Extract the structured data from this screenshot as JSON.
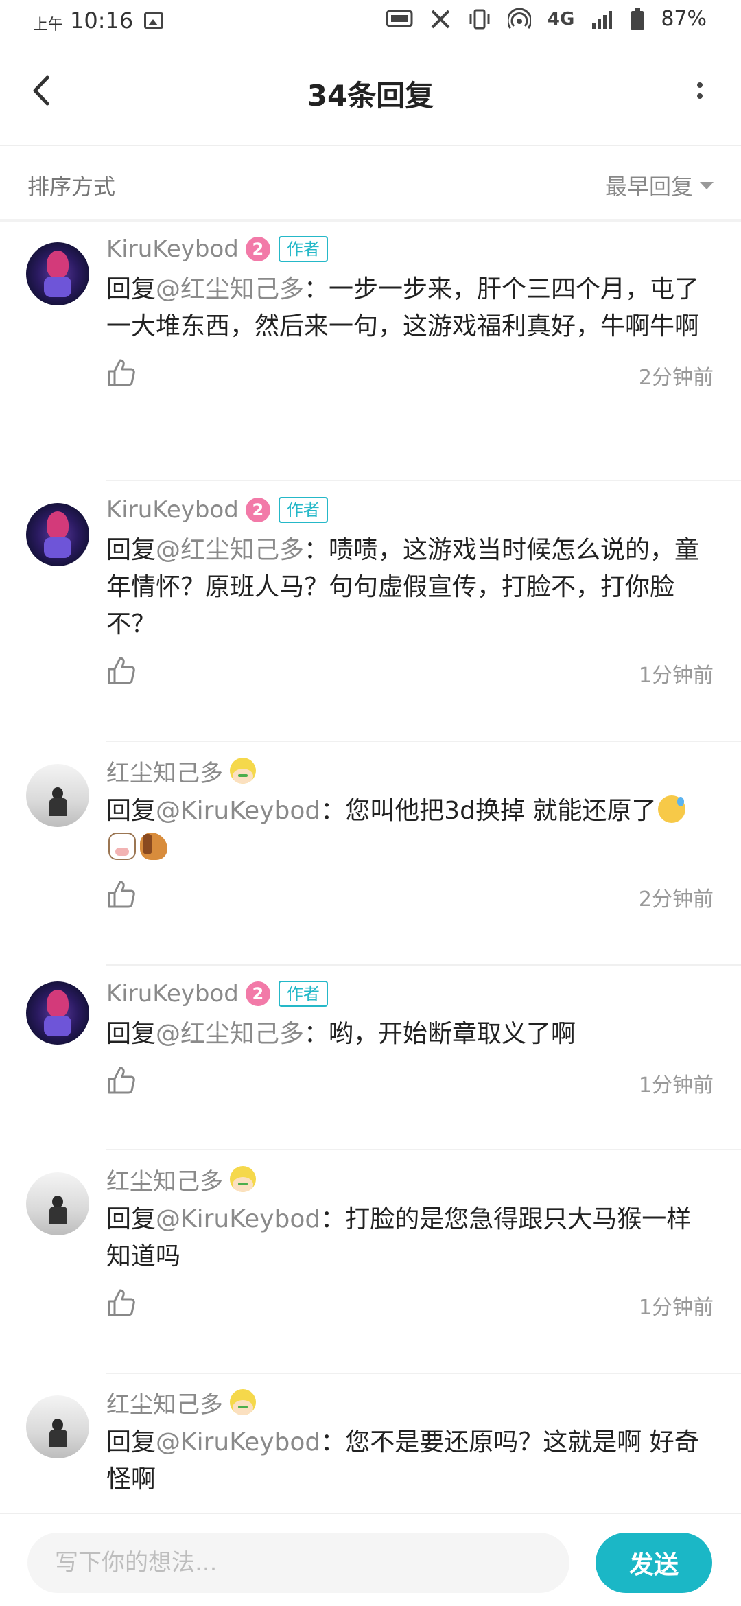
{
  "status_bar": {
    "ampm": "上午",
    "time": "10:16",
    "network": "4G",
    "battery": "87%",
    "icons": [
      "image-icon",
      "refresh-rate-120hz-icon",
      "x-app-icon",
      "vibrate-icon",
      "hotspot-icon",
      "signal-icon",
      "battery-icon"
    ]
  },
  "header": {
    "title": "34条回复"
  },
  "sort": {
    "label": "排序方式",
    "value": "最早回复"
  },
  "comments": [
    {
      "name": "KiruKeybod",
      "level": "2",
      "tag": "作者",
      "prefix": "回复",
      "mention": "@红尘知己多",
      "text": "：一步一步来，肝个三四个月，屯了一大堆东西，然后来一句，这游戏福利真好，牛啊牛啊",
      "time": "2分钟前"
    },
    {
      "name": "KiruKeybod",
      "level": "2",
      "tag": "作者",
      "prefix": "回复",
      "mention": "@红尘知己多",
      "text": "：啧啧，这游戏当时候怎么说的，童年情怀？原班人马？句句虚假宣传，打脸不，打你脸不？",
      "time": "1分钟前"
    },
    {
      "name": "红尘知己多",
      "prefix": "回复",
      "mention": "@KiruKeybod",
      "text": "：您叫他把3d换掉 就能还原了",
      "time": "2分钟前"
    },
    {
      "name": "KiruKeybod",
      "level": "2",
      "tag": "作者",
      "prefix": "回复",
      "mention": "@红尘知己多",
      "text": "：哟，开始断章取义了啊",
      "time": "1分钟前"
    },
    {
      "name": "红尘知己多",
      "prefix": "回复",
      "mention": "@KiruKeybod",
      "text": "：打脸的是您急得跟只大马猴一样知道吗",
      "time": "1分钟前"
    },
    {
      "name": "红尘知己多",
      "prefix": "回复",
      "mention": "@KiruKeybod",
      "text": "：您不是要还原吗？这就是啊 好奇怪啊"
    }
  ],
  "bottom": {
    "placeholder": "写下你的想法...",
    "send": "发送"
  },
  "colors": {
    "accent": "#1bb7c6",
    "author_tag": "#25b8c8",
    "level_badge": "#f27aa8",
    "muted_text": "#8a8a8a"
  }
}
